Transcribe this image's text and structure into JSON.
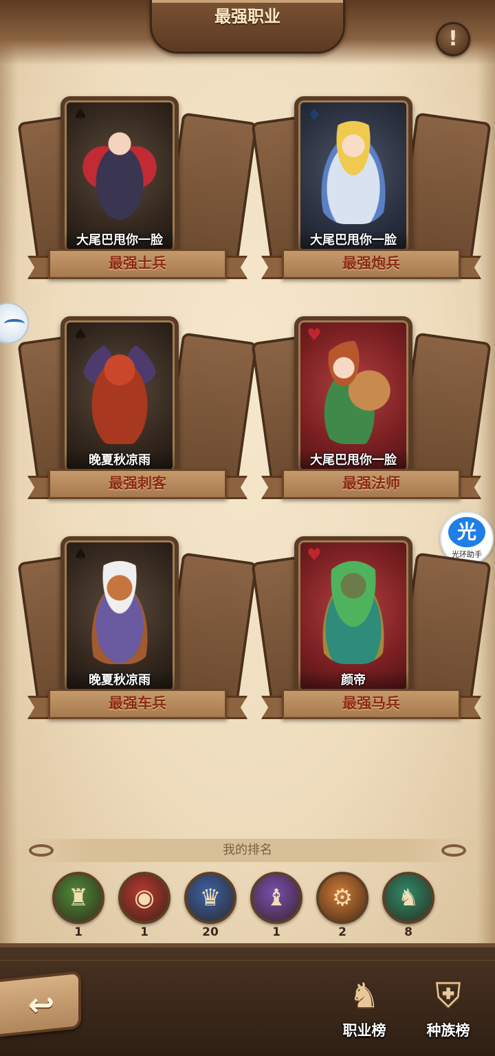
{
  "header": {
    "title": "最强职业",
    "info_icon_glyph": "!"
  },
  "cards": [
    {
      "suit": "♠",
      "suit_color": "spade",
      "bg": "dark",
      "character": "c-red",
      "player": "大尾巴甩你一脸",
      "title": "最强士兵"
    },
    {
      "suit": "♦",
      "suit_color": "diamond",
      "bg": "navy",
      "character": "c-blue",
      "player": "大尾巴甩你一脸",
      "title": "最强炮兵"
    },
    {
      "suit": "♠",
      "suit_color": "spade",
      "bg": "dark",
      "character": "c-demon",
      "player": "晚夏秋凉雨",
      "title": "最强刺客"
    },
    {
      "suit": "♥",
      "suit_color": "heart",
      "bg": "red",
      "character": "c-druid",
      "player": "大尾巴甩你一脸",
      "title": "最强法师"
    },
    {
      "suit": "♠",
      "suit_color": "spade",
      "bg": "dark",
      "character": "c-warrior",
      "player": "晚夏秋凉雨",
      "title": "最强车兵"
    },
    {
      "suit": "♥",
      "suit_color": "heart",
      "bg": "red",
      "character": "c-treant",
      "player": "颜帝",
      "title": "最强马兵"
    }
  ],
  "ranking": {
    "header": "我的排名",
    "items": [
      {
        "icon": "knight-helmet-icon",
        "glyph": "♜",
        "color": "#4f8a3a",
        "value": "1"
      },
      {
        "icon": "cannon-icon",
        "glyph": "◉",
        "color": "#b63a32",
        "value": "1"
      },
      {
        "icon": "maiden-icon",
        "glyph": "♛",
        "color": "#3b63a8",
        "value": "20"
      },
      {
        "icon": "wizard-hat-icon",
        "glyph": "♝",
        "color": "#7a4fb0",
        "value": "1"
      },
      {
        "icon": "chariot-icon",
        "glyph": "⚙",
        "color": "#d07a36",
        "value": "2"
      },
      {
        "icon": "horse-knight-icon",
        "glyph": "♞",
        "color": "#2f8a6a",
        "value": "8"
      }
    ]
  },
  "side_widgets": {
    "right_glyph": "光",
    "right_label": "光环助手"
  },
  "bottom_nav": {
    "back_glyph": "↩",
    "class_rank_label": "职业榜",
    "class_rank_glyph": "♞",
    "race_rank_label": "种族榜",
    "race_rank_glyph": "⛨"
  }
}
